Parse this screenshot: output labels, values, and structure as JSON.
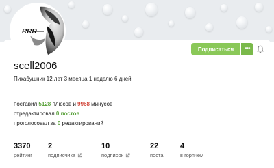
{
  "profile": {
    "nickname": "scell2006",
    "since": "Пикабушник 12 лет 3 месяца 1 неделю 6 дней",
    "avatar_logo": "RRR"
  },
  "actions": {
    "subscribe_label": "Подписаться",
    "more_label": "•••"
  },
  "activity": {
    "l1_prefix": "поставил ",
    "pluses": "5128",
    "l1_mid": " плюсов и ",
    "minuses": "9968",
    "l1_suffix": " минусов",
    "l2_prefix": "отредактировал ",
    "edits": "0 постов",
    "l3_prefix": "проголосовал за ",
    "votes": "0",
    "l3_suffix": " редактирований"
  },
  "metrics": [
    {
      "value": "3370",
      "label": "рейтинг"
    },
    {
      "value": "2",
      "label": "подписчика"
    },
    {
      "value": "10",
      "label": "подписок"
    },
    {
      "value": "22",
      "label": "поста"
    },
    {
      "value": "4",
      "label": "в горячем"
    }
  ],
  "colors": {
    "accent_green": "#8ac858",
    "plus_green": "#5ba23c",
    "minus_red": "#d2473b"
  }
}
